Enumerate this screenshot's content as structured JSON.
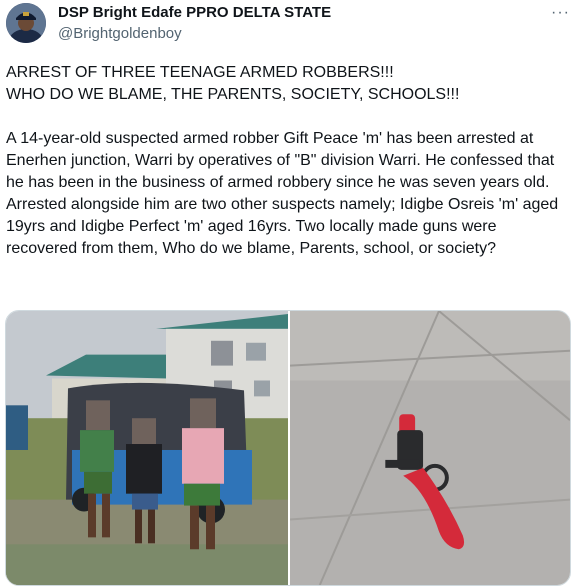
{
  "author": {
    "display_name": "DSP Bright Edafe PPRO DELTA STATE",
    "handle": "@Brightgoldenboy",
    "avatar_icon": "police-officer-avatar"
  },
  "more_icon": "···",
  "tweet": {
    "text": "ARREST OF THREE TEENAGE ARMED ROBBERS!!!\nWHO DO WE BLAME, THE PARENTS, SOCIETY, SCHOOLS!!!\n\nA 14-year-old suspected armed robber Gift Peace 'm' has been arrested at Enerhen junction, Warri by operatives of \"B\" division Warri. He confessed  that he has been in the business of armed robbery since he was seven years old. Arrested alongside him are two other suspects namely; Idigbe Osreis 'm' aged 19yrs and Idigbe Perfect 'm' aged 16yrs. Two locally made guns were recovered from them, Who do we blame, Parents, school, or society?"
  },
  "media": [
    {
      "kind": "photo",
      "subject": "three-suspects-beside-tricycle"
    },
    {
      "kind": "photo",
      "subject": "locally-made-gun-on-tiles"
    }
  ],
  "colors": {
    "text": "#0f1419",
    "secondary": "#536471",
    "border": "#cfd9de",
    "gun_red": "#d42a3a"
  }
}
